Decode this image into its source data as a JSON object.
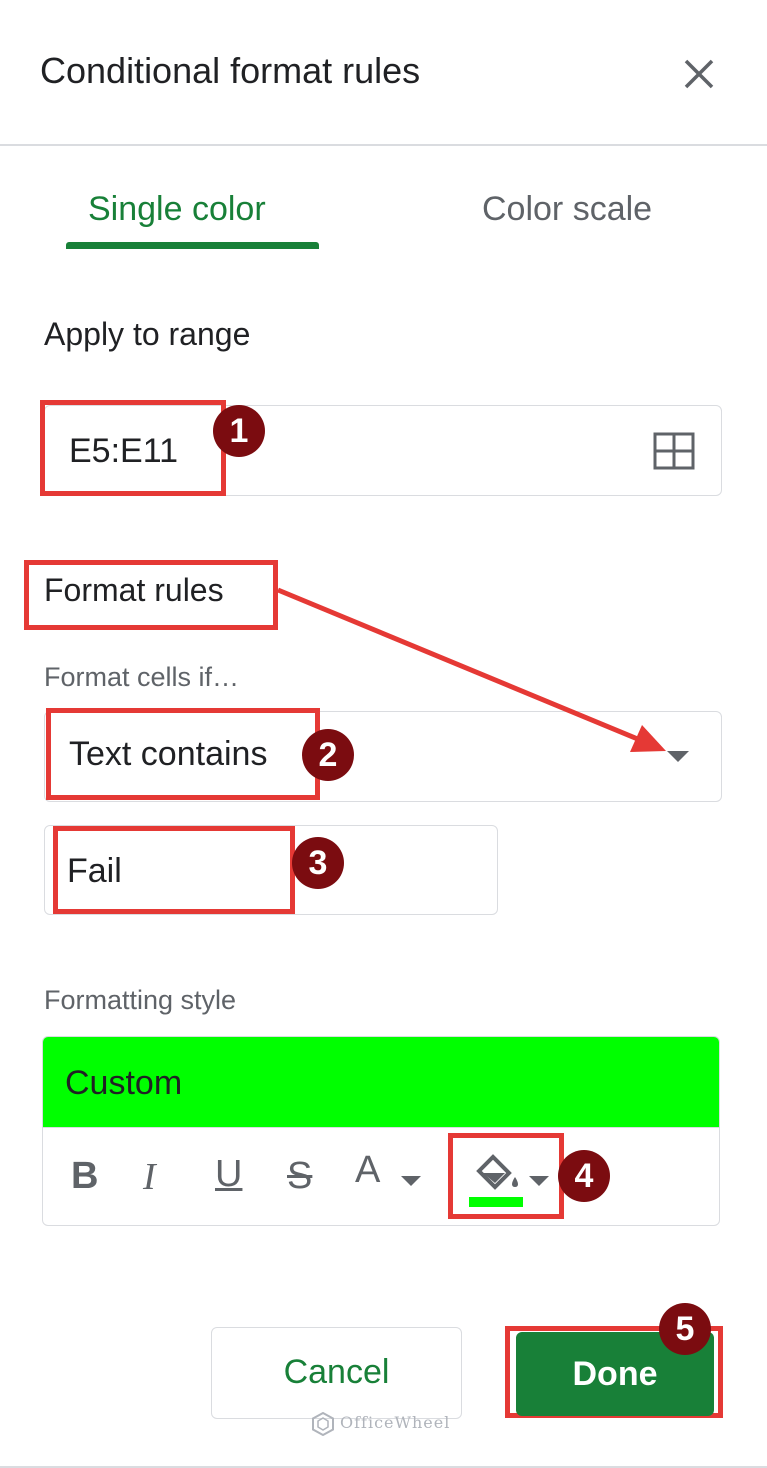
{
  "dialog": {
    "title": "Conditional format rules"
  },
  "tabs": [
    {
      "label": "Single color",
      "active": true
    },
    {
      "label": "Color scale",
      "active": false
    }
  ],
  "apply_range": {
    "heading": "Apply to range",
    "value": "E5:E11",
    "icon": "grid-select-icon"
  },
  "format_rules": {
    "heading": "Format rules",
    "condition_label": "Format cells if…",
    "condition_value": "Text contains",
    "value_input": "Fail"
  },
  "formatting_style": {
    "heading": "Formatting style",
    "preview_label": "Custom",
    "preview_color": "#00ff00",
    "fill_color": "#00ff00",
    "tools": {
      "bold": "B",
      "italic": "I",
      "underline": "U",
      "strikethrough": "S",
      "text_color": "A"
    }
  },
  "buttons": {
    "cancel": "Cancel",
    "done": "Done"
  },
  "callouts": [
    "1",
    "2",
    "3",
    "4",
    "5"
  ],
  "watermark": "OfficeWheel",
  "colors": {
    "accent": "#188038",
    "highlight": "#e53935",
    "badge": "#7b0c10"
  }
}
